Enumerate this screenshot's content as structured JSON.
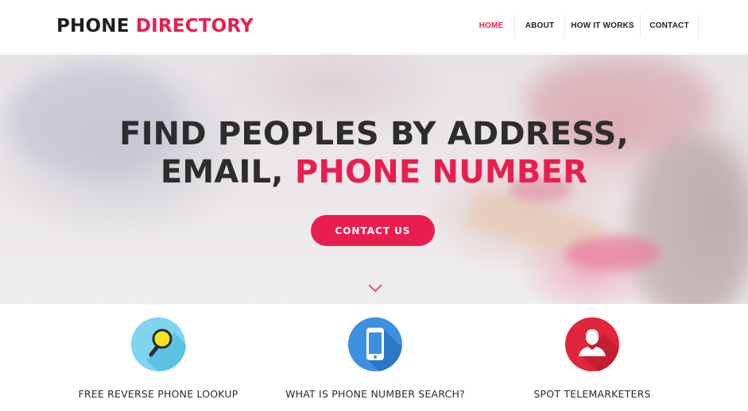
{
  "header": {
    "logo_part1": "PHONE",
    "logo_part2": "DIRECTORY",
    "nav": [
      "HOME",
      "ABOUT",
      "HOW IT WORKS",
      "CONTACT"
    ],
    "active": "HOME"
  },
  "hero": {
    "line1": "FIND PEOPLES BY ADDRESS,",
    "line2_plain": "EMAIL, ",
    "line2_highlight": "PHONE NUMBER",
    "cta_label": "CONTACT US",
    "scroll_icon": "chevron-down-icon"
  },
  "features": [
    {
      "label": "FREE REVERSE PHONE LOOKUP",
      "icon": "magnifier-icon",
      "color": "#7fd4ef"
    },
    {
      "label": "WHAT IS PHONE NUMBER SEARCH?",
      "icon": "smartphone-icon",
      "color": "#3d8fe0"
    },
    {
      "label": "SPOT TELEMARKETERS",
      "icon": "user-icon",
      "color": "#e0263c"
    }
  ],
  "colors": {
    "accent": "#e91e4f",
    "text": "#2d2d2d"
  }
}
